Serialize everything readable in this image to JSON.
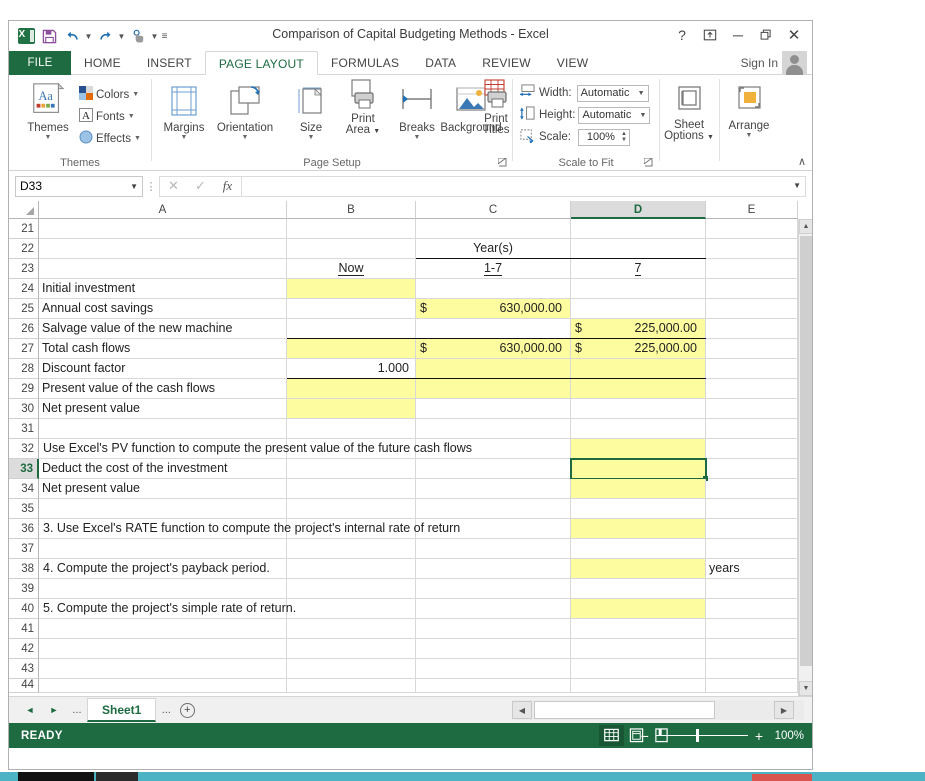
{
  "window": {
    "title": "Comparison of Capital Budgeting Methods - Excel",
    "buttons": {
      "help": "?",
      "ribbon_display": "⤒",
      "minimize": "─",
      "restore": "❐",
      "close": "✕"
    }
  },
  "quick_access": {
    "logo": "excel-logo",
    "save": "save-icon",
    "undo": "undo-icon",
    "redo": "redo-icon",
    "touch": "touch-mode-icon",
    "more": "more-icon"
  },
  "ribbon": {
    "tabs": [
      {
        "label": "FILE",
        "active": false
      },
      {
        "label": "HOME",
        "active": false
      },
      {
        "label": "INSERT",
        "active": false
      },
      {
        "label": "PAGE LAYOUT",
        "active": true
      },
      {
        "label": "FORMULAS",
        "active": false
      },
      {
        "label": "DATA",
        "active": false
      },
      {
        "label": "REVIEW",
        "active": false
      },
      {
        "label": "VIEW",
        "active": false
      }
    ],
    "sign_in": "Sign In",
    "groups": {
      "themes": {
        "label": "Themes",
        "themes_button": "Themes",
        "colors": "Colors",
        "fonts": "Fonts",
        "effects": "Effects"
      },
      "page_setup": {
        "label": "Page Setup",
        "items": [
          {
            "label": "Margins",
            "dropdown": true
          },
          {
            "label": "Orientation",
            "dropdown": true
          },
          {
            "label": "Size",
            "dropdown": true
          },
          {
            "label": "Print Area",
            "dropdown": true
          },
          {
            "label": "Breaks",
            "dropdown": true
          },
          {
            "label": "Background",
            "dropdown": false
          },
          {
            "label": "Print Titles",
            "dropdown": false
          }
        ]
      },
      "scale_to_fit": {
        "label": "Scale to Fit",
        "width_label": "Width:",
        "width_value": "Automatic",
        "height_label": "Height:",
        "height_value": "Automatic",
        "scale_label": "Scale:",
        "scale_value": "100%"
      },
      "sheet_options": {
        "label": "Sheet Options"
      },
      "arrange": {
        "label": "Arrange"
      }
    },
    "collapse": "∧"
  },
  "formula_bar": {
    "name_box": "D33",
    "cancel": "✕",
    "enter": "✓",
    "insert_function": "fx",
    "formula_value": ""
  },
  "grid": {
    "columns": [
      {
        "label": "A",
        "selected": false
      },
      {
        "label": "B",
        "selected": false
      },
      {
        "label": "C",
        "selected": false
      },
      {
        "label": "D",
        "selected": true
      },
      {
        "label": "E",
        "selected": false
      }
    ],
    "rows": [
      "21",
      "22",
      "23",
      "24",
      "25",
      "26",
      "27",
      "28",
      "29",
      "30",
      "31",
      "32",
      "33",
      "34",
      "35",
      "36",
      "37",
      "38",
      "39",
      "40",
      "41",
      "42",
      "43",
      "44"
    ],
    "selected_row": "33",
    "active_cell": "D33",
    "cells": {
      "A24": "Initial investment",
      "A25": "Annual cost savings",
      "A26": "Salvage value of the new machine",
      "A27": "Total cash flows",
      "A28": "Discount factor",
      "A29": "Present value of the cash flows",
      "A30": "Net present value",
      "A32": "Use Excel's PV function to compute the present value of the future cash flows",
      "A33": "Deduct the cost of the investment",
      "A34": "Net present value",
      "A36": "3. Use Excel's RATE function to compute the project's internal rate of return",
      "A38": "4. Compute the project's payback period.",
      "A40": "5. Compute the project's simple rate of return.",
      "B23": "Now",
      "B28": "1.000",
      "C22": "Year(s)",
      "C23": "1-7",
      "C25_sym": "$",
      "C25": "630,000.00",
      "C27_sym": "$",
      "C27": "630,000.00",
      "D23": "7",
      "D26_sym": "$",
      "D26": "225,000.00",
      "D27_sym": "$",
      "D27": "225,000.00",
      "E38": "years"
    }
  },
  "sheet_tabs": {
    "first": "◄",
    "last": "►",
    "left_dots": "...",
    "right_dots": "...",
    "sheets": [
      {
        "label": "Sheet1",
        "active": true
      }
    ],
    "add": "+"
  },
  "status_bar": {
    "status": "READY",
    "views": [
      {
        "name": "normal-view",
        "active": true
      },
      {
        "name": "page-layout-view",
        "active": false
      },
      {
        "name": "page-break-preview",
        "active": false
      }
    ],
    "zoom_out": "−",
    "zoom_in": "+",
    "zoom_level": "100%"
  },
  "colors": {
    "excel_green": "#1e6b41",
    "highlight_yellow": "#fdfda0",
    "taskbar_teal": "#4bb3c4"
  }
}
